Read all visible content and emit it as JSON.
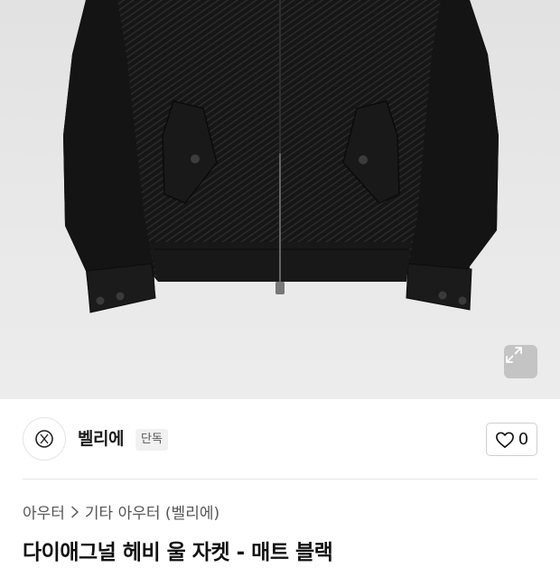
{
  "product": {
    "title": "다이애그널 헤비 울 자켓 - 매트 블랙"
  },
  "brand": {
    "name": "벨리에",
    "badge": "단독",
    "logo_icon": "brand-logo-emblem-icon"
  },
  "like": {
    "icon": "heart-outline-icon",
    "count": "0"
  },
  "breadcrumb": {
    "items": [
      "아우터",
      "기타 아우터 (벨리에)"
    ],
    "separator_icon": "chevron-right-icon"
  },
  "gallery": {
    "expand_icon": "expand-arrows-icon",
    "background_color": "#e6e6e6",
    "product_color": "#151515"
  }
}
